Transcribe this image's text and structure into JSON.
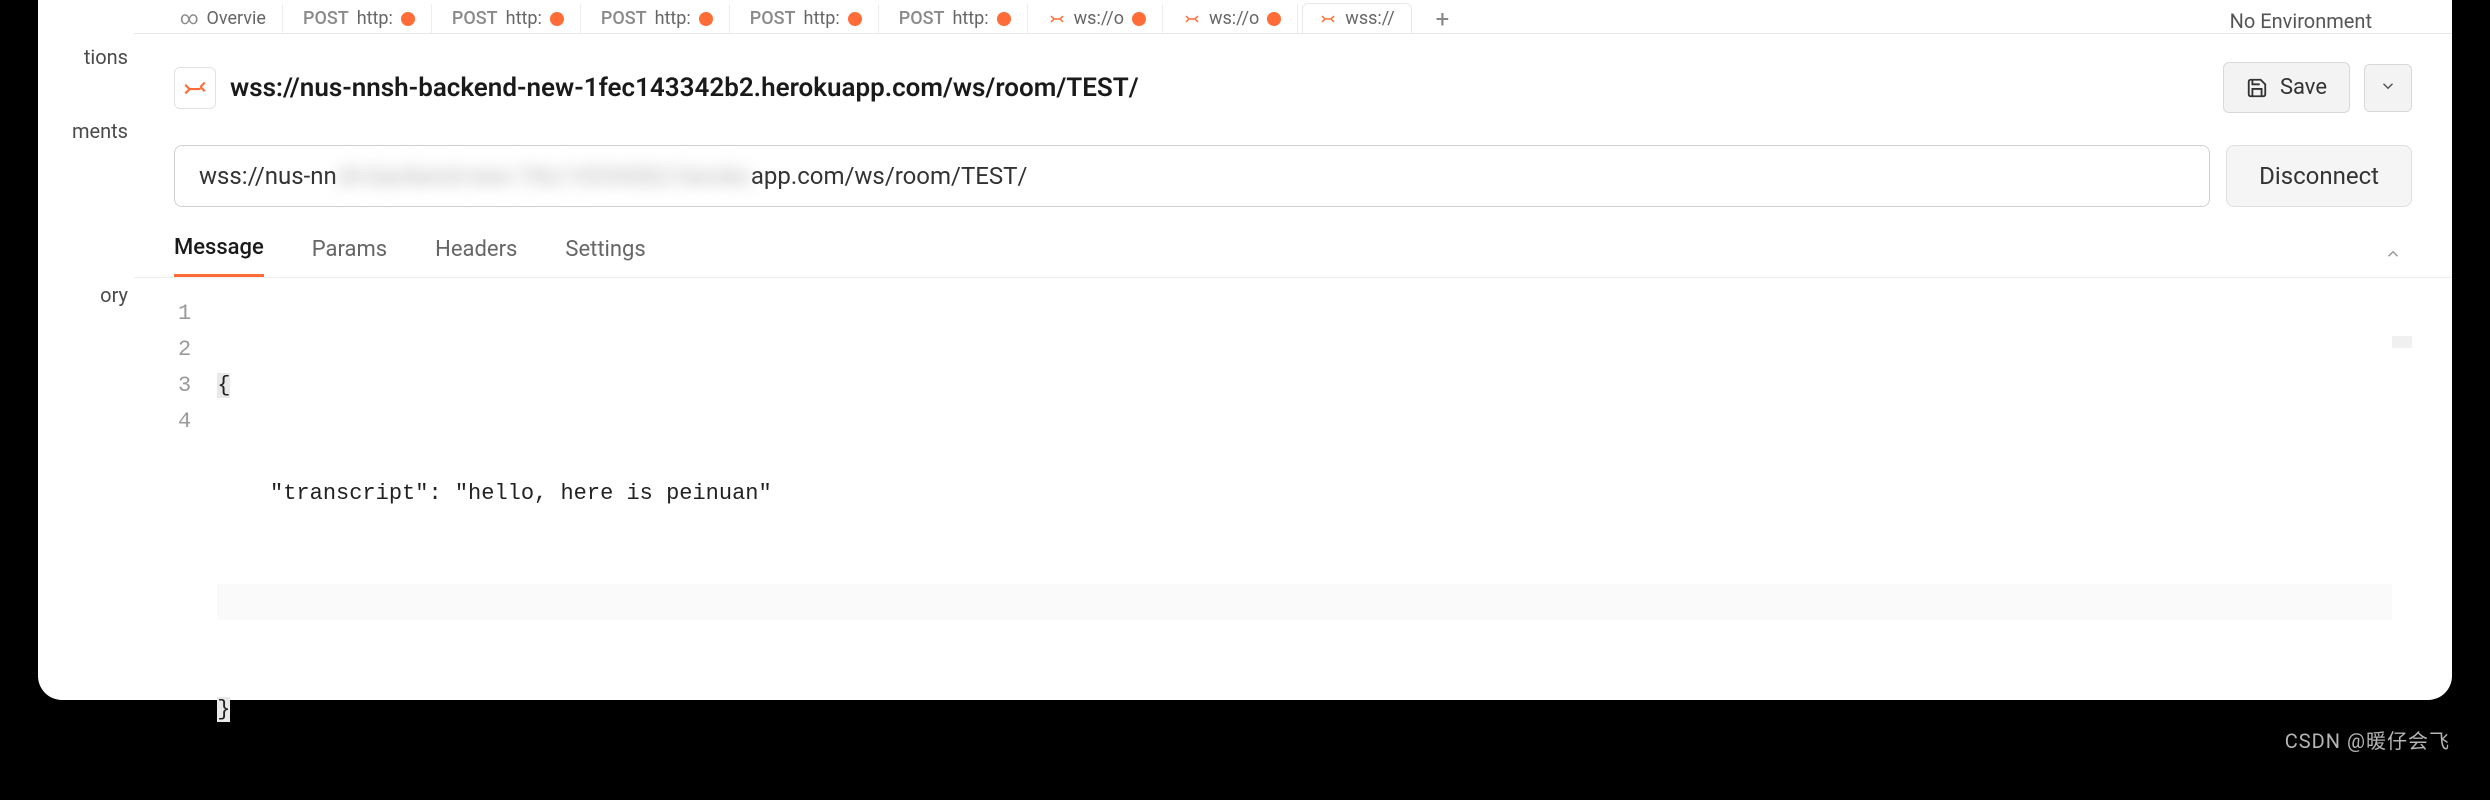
{
  "sidebar": {
    "items": [
      "tions",
      "ments",
      "",
      "ory"
    ]
  },
  "top_tabs": {
    "overview": {
      "label": "Overvie"
    },
    "items": [
      {
        "method": "POST",
        "path": "http:",
        "dirty": true
      },
      {
        "method": "POST",
        "path": "http:",
        "dirty": true
      },
      {
        "method": "POST",
        "path": "http:",
        "dirty": true
      },
      {
        "method": "POST",
        "path": "http:",
        "dirty": true
      },
      {
        "method": "POST",
        "path": "http:",
        "dirty": true
      },
      {
        "method": "WS",
        "path": "ws://o",
        "dirty": true
      },
      {
        "method": "WS",
        "path": "ws://o",
        "dirty": true
      },
      {
        "method": "WS",
        "path": "wss://",
        "dirty": false,
        "active": true
      }
    ],
    "env_label": "No Environment"
  },
  "request": {
    "title": "wss://nus-nnsh-backend-new-1fec143342b2.herokuapp.com/ws/room/TEST/",
    "save_label": "Save",
    "url_value_prefix": "wss://nus-nn",
    "url_value_blur": "sh-backend-new-1fec143342b2.heroku",
    "url_value_suffix": "app.com/ws/room/TEST/",
    "disconnect_label": "Disconnect"
  },
  "sub_tabs": {
    "items": [
      "Message",
      "Params",
      "Headers",
      "Settings"
    ],
    "active": "Message"
  },
  "editor": {
    "lines": [
      {
        "n": 1,
        "text": "{",
        "brace": true
      },
      {
        "n": 2,
        "text": "    \"transcript\": \"hello, here is peinuan\""
      },
      {
        "n": 3,
        "text": "",
        "highlight": true
      },
      {
        "n": 4,
        "text": "}",
        "brace": true
      }
    ]
  },
  "watermark": "CSDN @暖仔会飞"
}
